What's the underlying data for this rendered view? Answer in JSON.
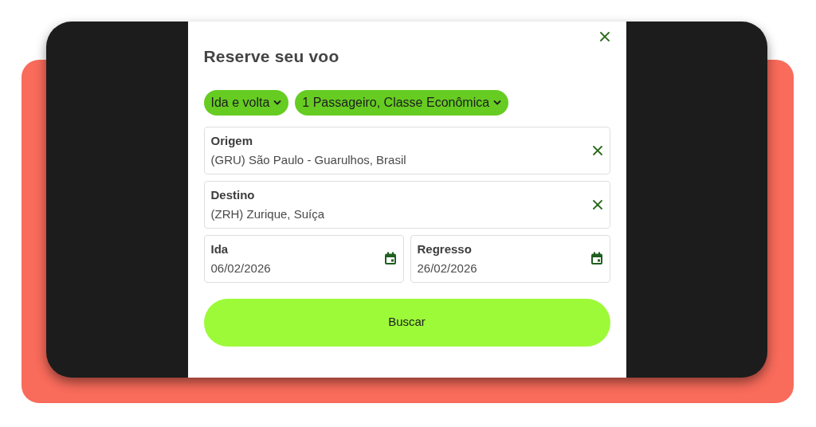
{
  "dialog": {
    "title": "Reserve seu voo",
    "dropdowns": [
      {
        "label": "Ida e volta"
      },
      {
        "label": "1 Passageiro, Classe Econômica"
      }
    ],
    "fields": [
      {
        "kind": "location",
        "label": "Origem",
        "value": "(GRU) São Paulo - Guarulhos, Brasil"
      },
      {
        "kind": "location",
        "label": "Destino",
        "value": "(ZRH) Zurique, Suíça"
      },
      {
        "kind": "date",
        "label": "Ida",
        "value": "06/02/2026"
      },
      {
        "kind": "date",
        "label": "Regresso",
        "value": "26/02/2026"
      }
    ],
    "search_button": "Buscar"
  }
}
